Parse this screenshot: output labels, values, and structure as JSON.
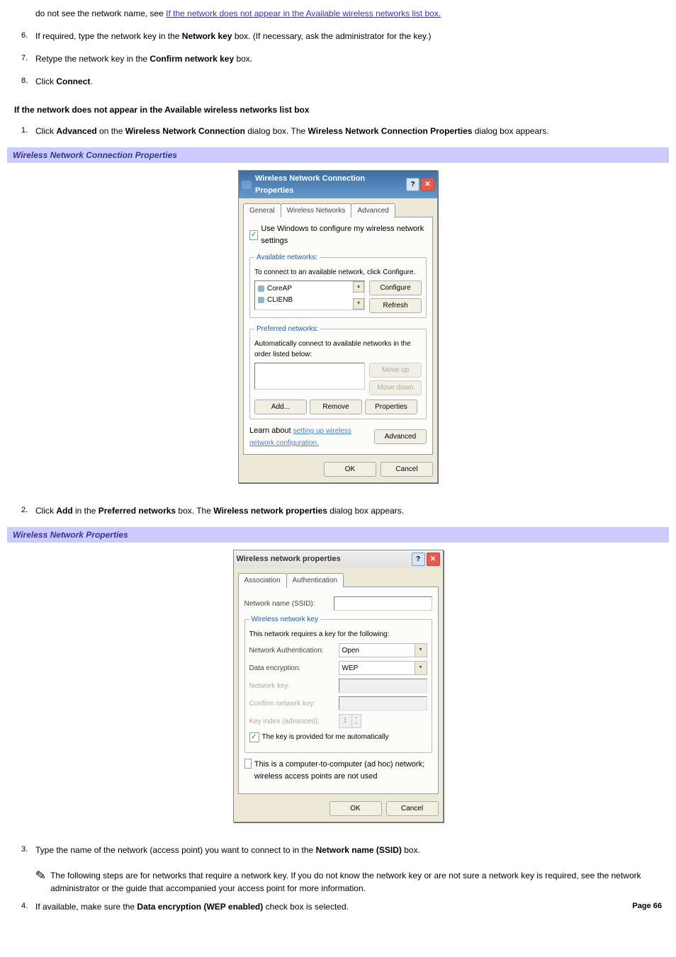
{
  "intro_step_text_prefix": "do not see the network name, see ",
  "intro_step_link": "If the network does not appear in the Available wireless networks list box.",
  "steps_a": [
    {
      "n": "6.",
      "text_before": "If required, type the network key in the ",
      "bold": "Network key",
      "text_after": " box. (If necessary, ask the administrator for the key.)"
    },
    {
      "n": "7.",
      "text_before": "Retype the network key in the ",
      "bold": "Confirm network key",
      "text_after": " box."
    },
    {
      "n": "8.",
      "text_before": "Click ",
      "bold": "Connect",
      "text_after": "."
    }
  ],
  "section_heading": "If the network does not appear in the Available wireless networks list box",
  "step_b1": {
    "n": "1.",
    "parts": [
      "Click ",
      "Advanced",
      " on the ",
      "Wireless Network Connection",
      " dialog box. The ",
      "Wireless Network Connection Properties",
      " dialog box appears."
    ]
  },
  "caption1": "Wireless Network Connection Properties",
  "dlg1": {
    "title": "Wireless Network Connection Properties",
    "help": "?",
    "close": "✕",
    "tabs": [
      "General",
      "Wireless Networks",
      "Advanced"
    ],
    "use_windows": "Use Windows to configure my wireless network settings",
    "avail_legend": "Available networks:",
    "avail_text": "To connect to an available network, click Configure.",
    "networks": [
      "CoreAP",
      "CLIENB"
    ],
    "btn_configure": "Configure",
    "btn_refresh": "Refresh",
    "pref_legend": "Preferred networks:",
    "pref_text": "Automatically connect to available networks in the order listed below:",
    "btn_moveup": "Move up",
    "btn_movedown": "Move down",
    "btn_add": "Add...",
    "btn_remove": "Remove",
    "btn_properties": "Properties",
    "learn_prefix": "Learn about ",
    "learn_link": "setting up wireless network configuration.",
    "btn_advanced": "Advanced",
    "btn_ok": "OK",
    "btn_cancel": "Cancel"
  },
  "step_b2": {
    "n": "2.",
    "parts": [
      "Click ",
      "Add",
      " in the ",
      "Preferred networks",
      " box. The ",
      "Wireless network properties",
      " dialog box appears."
    ]
  },
  "caption2": "Wireless Network Properties",
  "dlg2": {
    "title": "Wireless network properties",
    "help": "?",
    "close": "✕",
    "tabs": [
      "Association",
      "Authentication"
    ],
    "ssid_label": "Network name (SSID):",
    "wnk_legend": "Wireless network key",
    "wnk_text": "This network requires a key for the following:",
    "auth_label": "Network Authentication:",
    "auth_value": "Open",
    "enc_label": "Data encryption:",
    "enc_value": "WEP",
    "key_label": "Network key:",
    "confirm_label": "Confirm network key:",
    "keyidx_label": "Key index (advanced):",
    "keyidx_value": "1",
    "auto_chk": "The key is provided for me automatically",
    "adhoc_chk": "This is a computer-to-computer (ad hoc) network; wireless access points are not used",
    "btn_ok": "OK",
    "btn_cancel": "Cancel"
  },
  "step_b3": {
    "n": "3.",
    "parts": [
      "Type the name of the network (access point) you want to connect to in the ",
      "Network name (SSID)",
      " box."
    ]
  },
  "note_icon": "✎",
  "note_text": "The following steps are for networks that require a network key. If you do not know the network key or are not sure a network key is required, see the network administrator or the guide that accompanied your access point for more information.",
  "step_b4": {
    "n": "4.",
    "parts": [
      "If available, make sure the ",
      "Data encryption (WEP enabled)",
      " check box is selected."
    ]
  },
  "page_num": "Page 66"
}
